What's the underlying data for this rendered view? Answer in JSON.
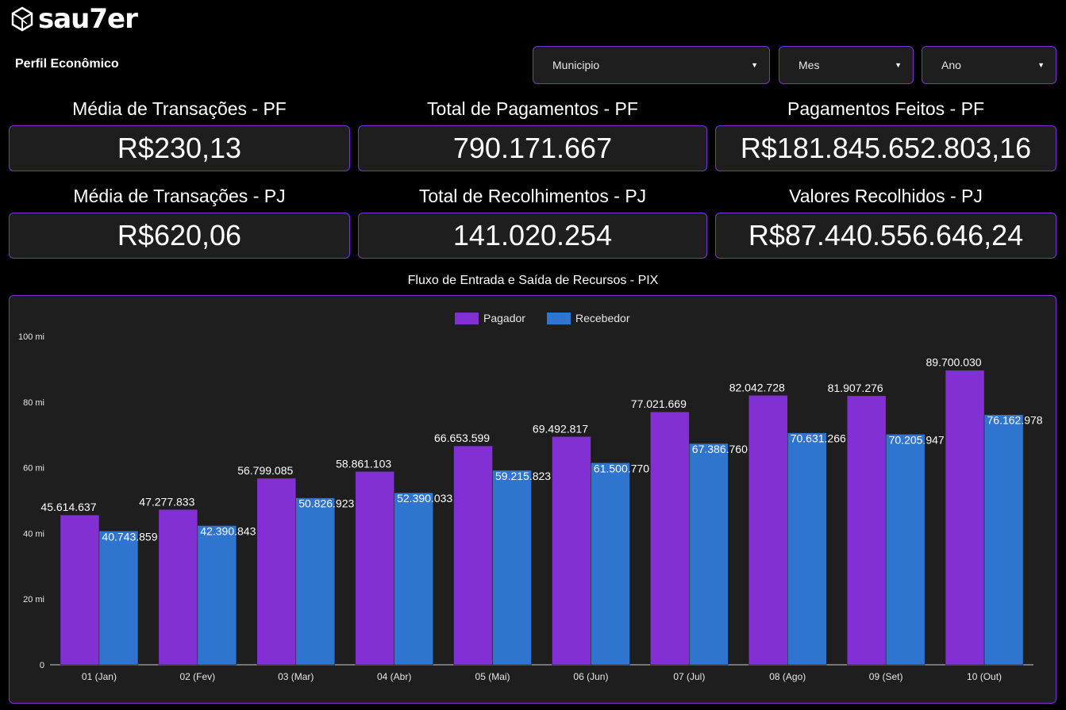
{
  "brand": {
    "name": "sau7er"
  },
  "page": {
    "title": "Perfil Econômico"
  },
  "filters": [
    {
      "label": "Municipio"
    },
    {
      "label": "Mes"
    },
    {
      "label": "Ano"
    }
  ],
  "kpis": [
    {
      "label": "Média de Transações - PF",
      "value": "R$230,13"
    },
    {
      "label": "Total de Pagamentos - PF",
      "value": "790.171.667"
    },
    {
      "label": "Pagamentos Feitos - PF",
      "value": "R$181.845.652.803,16"
    },
    {
      "label": "Média de Transações - PJ",
      "value": "R$620,06"
    },
    {
      "label": "Total de Recolhimentos - PJ",
      "value": "141.020.254"
    },
    {
      "label": "Valores Recolhidos - PJ",
      "value": "R$87.440.556.646,24"
    }
  ],
  "colors": {
    "accent": "#7b33d6",
    "pagador": "#8230d3",
    "recebedor": "#2f75d0",
    "panel": "#1e1e1e"
  },
  "chart_data": {
    "type": "bar",
    "title": "Fluxo de Entrada e Saída de Recursos - PIX",
    "categories": [
      "01 (Jan)",
      "02 (Fev)",
      "03 (Mar)",
      "04 (Abr)",
      "05 (Mai)",
      "06 (Jun)",
      "07 (Jul)",
      "08 (Ago)",
      "09 (Set)",
      "10 (Out)"
    ],
    "series": [
      {
        "name": "Pagador",
        "values": [
          45614637,
          47277833,
          56799085,
          58861103,
          66653599,
          69492817,
          77021669,
          82042728,
          81907276,
          89700030
        ],
        "labels": [
          "45.614.637",
          "47.277.833",
          "56.799.085",
          "58.861.103",
          "66.653.599",
          "69.492.817",
          "77.021.669",
          "82.042.728",
          "81.907.276",
          "89.700.030"
        ]
      },
      {
        "name": "Recebedor",
        "values": [
          40743859,
          42390843,
          50826923,
          52390033,
          59215823,
          61500770,
          67386760,
          70631266,
          70205947,
          76162978
        ],
        "labels": [
          "40.743.859",
          "42.390.843",
          "50.826.923",
          "52.390.033",
          "59.215.823",
          "61.500.770",
          "67.386.760",
          "70.631.266",
          "70.205.947",
          "76.162.978"
        ]
      }
    ],
    "yticks": [
      "0",
      "20 mi",
      "40 mi",
      "60 mi",
      "80 mi",
      "100 mi"
    ],
    "ylim": [
      0,
      100000000
    ],
    "legend": "top-center",
    "grid": false
  }
}
